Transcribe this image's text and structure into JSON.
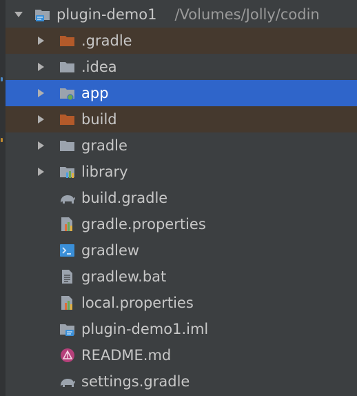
{
  "project": {
    "name": "plugin-demo1",
    "path": "/Volumes/Jolly/codin"
  },
  "items": [
    {
      "label": ".gradle",
      "icon": "folder-excluded-icon",
      "expandable": true,
      "state": "excluded"
    },
    {
      "label": ".idea",
      "icon": "folder-icon",
      "expandable": true,
      "state": "normal"
    },
    {
      "label": "app",
      "icon": "module-folder-icon",
      "expandable": true,
      "state": "selected"
    },
    {
      "label": "build",
      "icon": "folder-excluded-icon",
      "expandable": true,
      "state": "excluded"
    },
    {
      "label": "gradle",
      "icon": "folder-icon",
      "expandable": true,
      "state": "normal"
    },
    {
      "label": "library",
      "icon": "library-folder-icon",
      "expandable": true,
      "state": "normal"
    },
    {
      "label": "build.gradle",
      "icon": "gradle-elephant-icon",
      "expandable": false,
      "state": "normal"
    },
    {
      "label": "gradle.properties",
      "icon": "properties-file-icon",
      "expandable": false,
      "state": "normal"
    },
    {
      "label": "gradlew",
      "icon": "shell-script-icon",
      "expandable": false,
      "state": "normal"
    },
    {
      "label": "gradlew.bat",
      "icon": "text-file-icon",
      "expandable": false,
      "state": "normal"
    },
    {
      "label": "local.properties",
      "icon": "properties-file-icon",
      "expandable": false,
      "state": "normal"
    },
    {
      "label": "plugin-demo1.iml",
      "icon": "iml-module-file-icon",
      "expandable": false,
      "state": "normal"
    },
    {
      "label": "README.md",
      "icon": "markdown-file-icon",
      "expandable": false,
      "state": "normal"
    },
    {
      "label": "settings.gradle",
      "icon": "gradle-elephant-icon",
      "expandable": false,
      "state": "normal"
    }
  ],
  "colors": {
    "background": "#3c3f41",
    "selection": "#2f65ca",
    "excluded_row": "#45392e",
    "folder_gray": "#9ba3ad",
    "folder_excluded": "#b35a2a",
    "text": "#c7c7c7",
    "path_text": "#9a9a9a"
  }
}
